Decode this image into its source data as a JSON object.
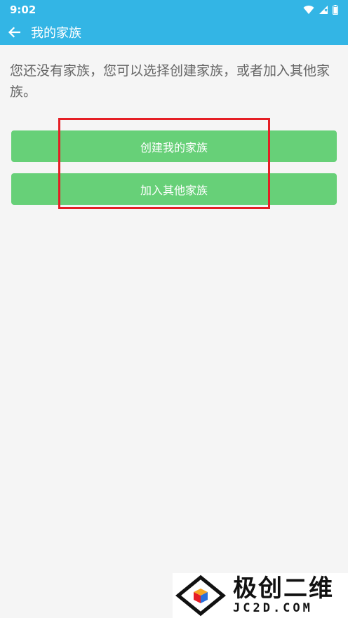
{
  "status_bar": {
    "time": "9:02",
    "icons": [
      "wifi-icon",
      "signal-icon",
      "battery-icon"
    ]
  },
  "app_bar": {
    "title": "我的家族",
    "back_icon": "arrow-left-icon"
  },
  "main": {
    "message": "您还没有家族，您可以选择创建家族，或者加入其他家族。",
    "create_button_label": "创建我的家族",
    "join_button_label": "加入其他家族"
  },
  "watermark": {
    "main_text": "极创二维",
    "sub_text": "JC2D.COM"
  },
  "colors": {
    "primary": "#33b5e5",
    "button": "#67d078",
    "highlight": "#e51e25",
    "background": "#f5f5f5"
  }
}
